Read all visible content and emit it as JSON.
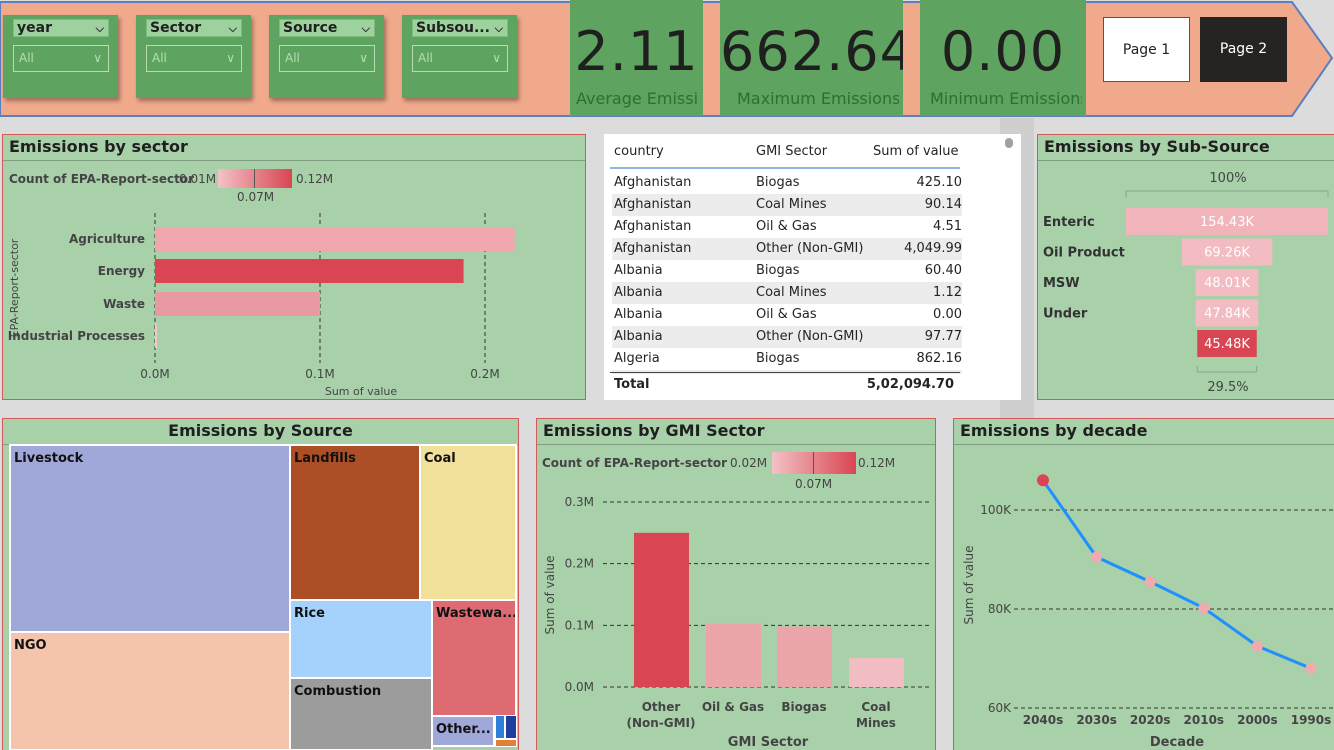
{
  "filters": [
    {
      "title": "year",
      "value": "All"
    },
    {
      "title": "Sector",
      "value": "All"
    },
    {
      "title": "Source",
      "value": "All"
    },
    {
      "title": "Subsou...",
      "value": "All"
    }
  ],
  "kpis": [
    {
      "value": "2.11",
      "label": "Average Emissi..."
    },
    {
      "value": "662.64",
      "label": "Maximum Emissions"
    },
    {
      "value": "0.00",
      "label": "Minimum Emissions"
    }
  ],
  "pages": {
    "page1": "Page 1",
    "page2": "Page 2"
  },
  "colors": {
    "banner": "#f0a98a",
    "green": "#5ea35f",
    "panel": "#a8d1aa",
    "accent": "#d94552",
    "pink": "#e8a0a8",
    "line": "#1e90ff"
  },
  "sector_chart": {
    "title": "Emissions by sector",
    "legend": {
      "label": "Count of EPA-Report-sector",
      "min": "0.01M",
      "max": "0.12M",
      "mid": "0.07M"
    },
    "ylabel": "EPA-Report-sector",
    "xlabel": "Sum of value",
    "xticks": [
      "0.0M",
      "0.1M",
      "0.2M"
    ],
    "bar_colors": [
      "#f0a8ae",
      "#d94552",
      "#e89aa2",
      "#f4c6ca"
    ]
  },
  "table": {
    "headers": [
      "country",
      "GMI Sector",
      "Sum of value"
    ],
    "rows": [
      [
        "Afghanistan",
        "Biogas",
        "425.10"
      ],
      [
        "Afghanistan",
        "Coal Mines",
        "90.14"
      ],
      [
        "Afghanistan",
        "Oil & Gas",
        "4.51"
      ],
      [
        "Afghanistan",
        "Other (Non-GMI)",
        "4,049.99"
      ],
      [
        "Albania",
        "Biogas",
        "60.40"
      ],
      [
        "Albania",
        "Coal Mines",
        "1.12"
      ],
      [
        "Albania",
        "Oil & Gas",
        "0.00"
      ],
      [
        "Albania",
        "Other (Non-GMI)",
        "97.77"
      ],
      [
        "Algeria",
        "Biogas",
        "862.16"
      ]
    ],
    "total_label": "Total",
    "total_value": "5,02,094.70"
  },
  "subsource_chart": {
    "title": "Emissions by Sub-Source",
    "top_pct": "100%",
    "bottom_pct": "29.5%",
    "bar_colors": [
      "#f0b4ba",
      "#f2bcc2",
      "#f2bcc2",
      "#f2bcc2",
      "#d94552"
    ]
  },
  "source_chart": {
    "title": "Emissions by Source",
    "nodes": [
      {
        "label": "Livestock",
        "color": "#a0a8da"
      },
      {
        "label": "NGO",
        "color": "#f4c4ac"
      },
      {
        "label": "Landfills",
        "color": "#ac4f26"
      },
      {
        "label": "Coal",
        "color": "#f0e09a"
      },
      {
        "label": "Rice",
        "color": "#a4d2fc"
      },
      {
        "label": "Combustion",
        "color": "#9c9c9c"
      },
      {
        "label": "Wastewa...",
        "color": "#de6a72"
      },
      {
        "label": "Other...",
        "color": "#a0a8da"
      }
    ]
  },
  "gmi_chart": {
    "title": "Emissions by GMI Sector",
    "legend": {
      "label": "Count of EPA-Report-sector",
      "min": "0.02M",
      "max": "0.12M",
      "mid": "0.07M"
    },
    "ylabel": "Sum of value",
    "xlabel": "GMI Sector",
    "yticks": [
      "0.0M",
      "0.1M",
      "0.2M",
      "0.3M"
    ],
    "bar_colors": [
      "#d94552",
      "#eca4ab",
      "#eca4ab",
      "#f2bdc2"
    ]
  },
  "decade_chart": {
    "title": "Emissions by decade",
    "ylabel": "Sum of value",
    "xlabel": "Decade",
    "yticks": [
      "60K",
      "80K",
      "100K"
    ]
  },
  "chart_data": [
    {
      "type": "bar",
      "orientation": "horizontal",
      "title": "Emissions by sector",
      "categories": [
        "Agriculture",
        "Energy",
        "Waste",
        "Industrial Processes"
      ],
      "values": [
        218000,
        187000,
        100000,
        1000
      ],
      "xlabel": "Sum of value",
      "ylabel": "EPA-Report-sector",
      "xlim": [
        0,
        240000
      ],
      "grid": true
    },
    {
      "type": "bar",
      "orientation": "horizontal",
      "title": "Emissions by Sub-Source",
      "categories": [
        "Enteric",
        "Oil Product",
        "MSW",
        "Under",
        ""
      ],
      "values": [
        154430,
        69260,
        48010,
        47840,
        45480
      ],
      "labels": [
        "154.43K",
        "69.26K",
        "48.01K",
        "47.84K",
        "45.48K"
      ]
    },
    {
      "type": "heatmap",
      "subtype": "treemap",
      "title": "Emissions by Source",
      "categories": [
        "Livestock",
        "NGO",
        "Landfills",
        "Coal",
        "Rice",
        "Combustion",
        "Wastewa...",
        "Other..."
      ],
      "values": [
        0.282,
        0.187,
        0.153,
        0.11,
        0.085,
        0.073,
        0.092,
        0.018
      ]
    },
    {
      "type": "bar",
      "title": "Emissions by GMI Sector",
      "categories": [
        "Other (Non-GMI)",
        "Oil & Gas",
        "Biogas",
        "Coal Mines"
      ],
      "values": [
        250000,
        103000,
        98000,
        47000
      ],
      "xlabel": "GMI Sector",
      "ylabel": "Sum of value",
      "ylim": [
        0,
        330000
      ],
      "grid": true
    },
    {
      "type": "line",
      "title": "Emissions by decade",
      "categories": [
        "2040s",
        "2030s",
        "2020s",
        "2010s",
        "2000s",
        "1990s"
      ],
      "values": [
        106000,
        90500,
        85500,
        80200,
        72500,
        68000
      ],
      "xlabel": "Decade",
      "ylabel": "Sum of value",
      "ylim": [
        60000,
        110000
      ],
      "grid": true
    }
  ]
}
